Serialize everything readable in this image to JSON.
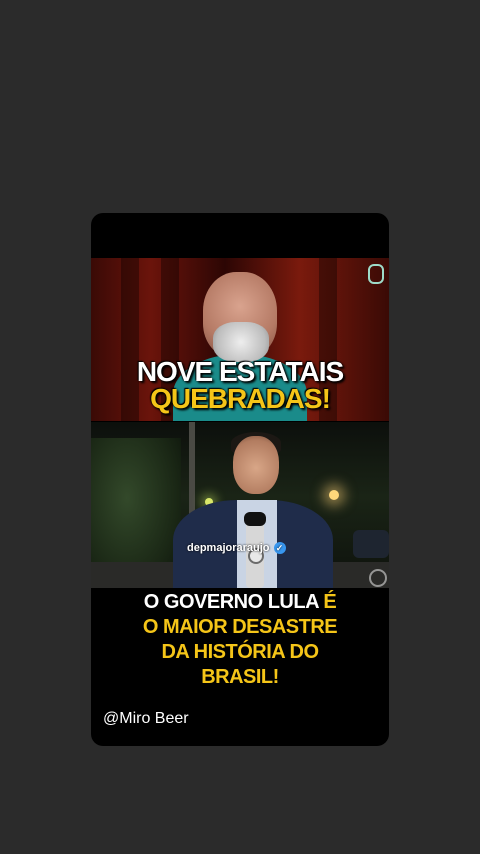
{
  "headline_top": {
    "line1": "NOVE ESTATAIS",
    "line2": "QUEBRADAS!"
  },
  "headline_bottom": {
    "line1_a": "O GOVERNO LULA ",
    "line1_b": "É",
    "line2": "O MAIOR DESASTRE",
    "line3": "DA HISTÓRIA DO",
    "line4": "BRASIL!"
  },
  "watermark": {
    "handle": "depmajoraraujo",
    "verified_icon": "verified-check-icon",
    "verified_glyph": "✓"
  },
  "user_tag": "@Miro Beer",
  "icons": {
    "podcast": "microphone-icon",
    "tv": "tv-network-logo-icon"
  },
  "colors": {
    "background": "#2b2b2b",
    "highlight_yellow": "#f5c518",
    "text_white": "#ffffff",
    "verified_blue": "#3897f0"
  }
}
